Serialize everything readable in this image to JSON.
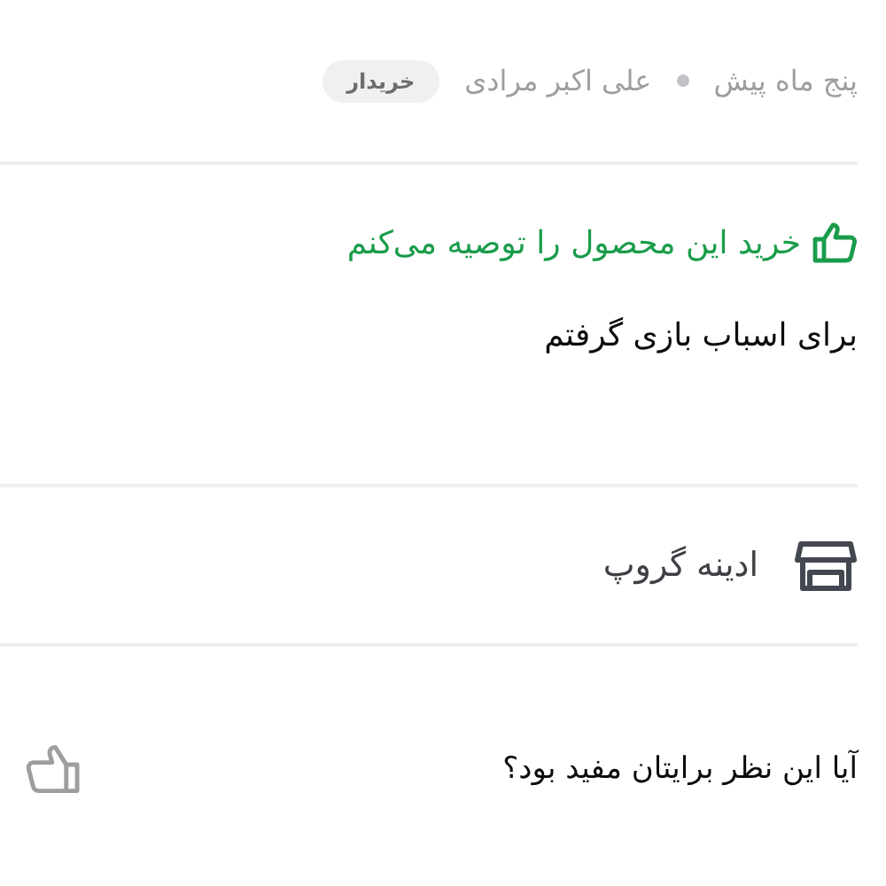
{
  "review": {
    "date": "پنج ماه پیش",
    "author": "علی اکبر مرادی",
    "badge": "خریدار",
    "recommendation": {
      "recommended": true,
      "text": "خرید این محصول را توصیه می‌کنم"
    },
    "body": "برای اسباب بازی گرفتم"
  },
  "seller": {
    "name": "ادینه گروپ"
  },
  "helpful": {
    "question": "آیا این نظر برایتان مفید بود؟"
  }
}
